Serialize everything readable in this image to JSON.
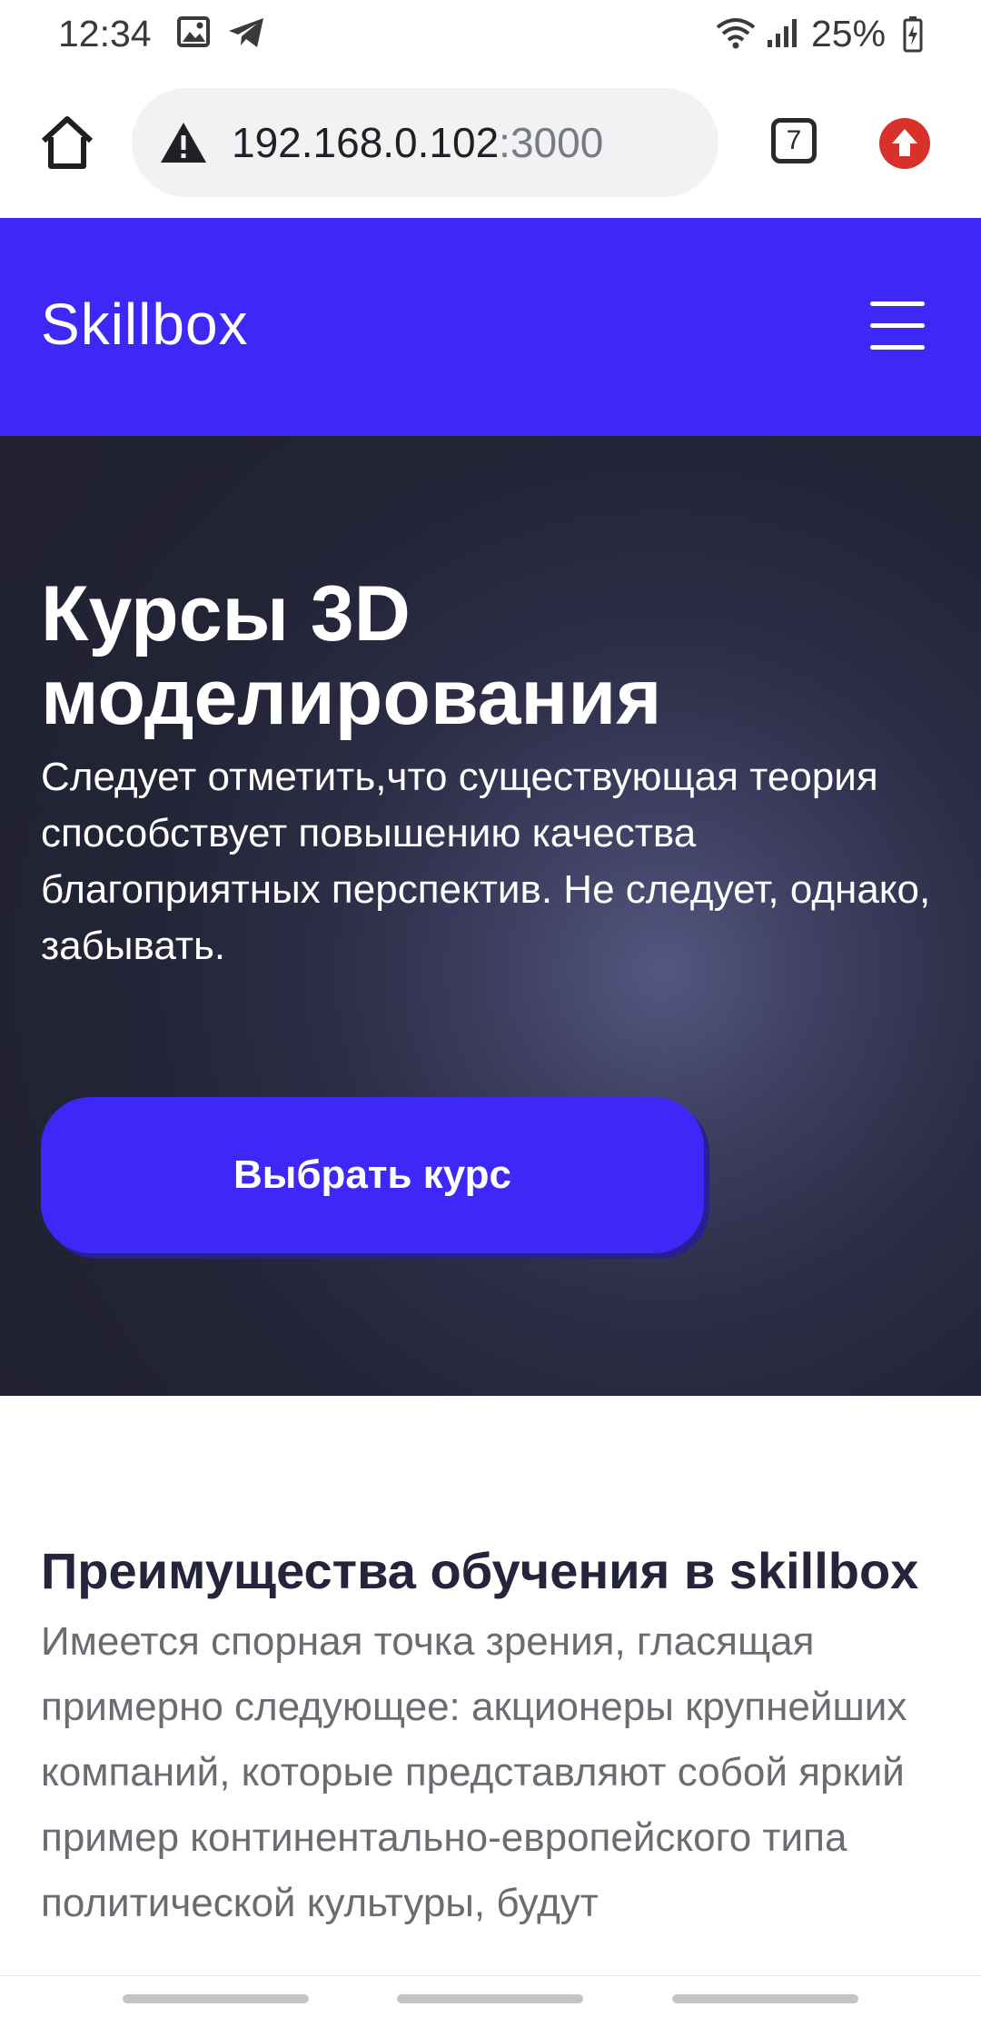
{
  "status_bar": {
    "time": "12:34",
    "battery": "25%",
    "icons": [
      "image-icon",
      "telegram-icon",
      "wifi-icon",
      "signal-icon",
      "battery-charging-icon"
    ]
  },
  "browser": {
    "url_host": "192.168.0.102",
    "url_port": ":3000",
    "tab_count": "7",
    "icons": [
      "home-icon",
      "warning-icon",
      "tabs-icon",
      "update-icon"
    ]
  },
  "header": {
    "logo": "Skillbox",
    "background": "#3d28f8",
    "menu_icon": "hamburger-icon"
  },
  "hero": {
    "title": "Курсы 3D моделирования",
    "text": "Следует отметить,что существующая теория способствует повышению качества благоприятных перспектив. Не следует, однако, забывать.",
    "button_label": "Выбрать курс"
  },
  "advantages": {
    "title": "Преимущества обучения в skillbox",
    "text": "Имеется спорная точка зрения, гласящая примерно следующее: акционеры крупнейших компаний, которые представляют собой яркий пример континентально-европейского типа политической культуры, будут"
  }
}
